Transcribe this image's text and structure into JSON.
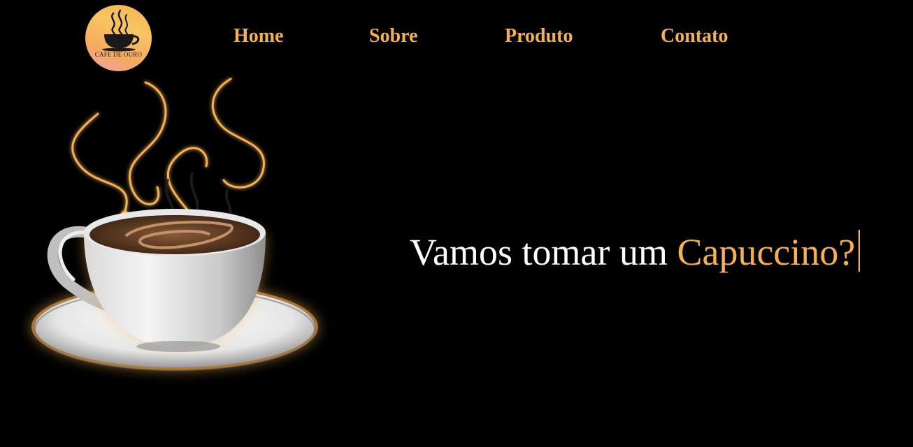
{
  "logo": {
    "text": "CAFE DE OURO",
    "icon": "coffee-cup-icon"
  },
  "nav": {
    "items": [
      {
        "label": "Home"
      },
      {
        "label": "Sobre"
      },
      {
        "label": "Produto"
      },
      {
        "label": "Contato"
      }
    ]
  },
  "hero": {
    "headline_prefix": "Vamos tomar um ",
    "headline_accent": "Capuccino?",
    "image": "coffee-cup-steam-illustration"
  },
  "colors": {
    "background": "#000000",
    "accent": "#f5b054",
    "text": "#ffffff"
  }
}
